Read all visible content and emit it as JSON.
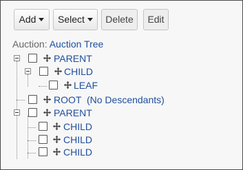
{
  "toolbar": {
    "add_label": "Add",
    "select_label": "Select",
    "delete_label": "Delete",
    "edit_label": "Edit"
  },
  "tree": {
    "title_prefix": "Auction:",
    "title_link": "Auction Tree",
    "nodes": [
      {
        "label": "PARENT",
        "level": 0,
        "expanded": true
      },
      {
        "label": "CHILD",
        "level": 1,
        "expanded": true
      },
      {
        "label": "LEAF",
        "level": 2
      },
      {
        "label": "ROOT  (No Descendants)",
        "level": 0
      },
      {
        "label": "PARENT",
        "level": 0,
        "expanded": true
      },
      {
        "label": "CHILD",
        "level": 1
      },
      {
        "label": "CHILD",
        "level": 1
      },
      {
        "label": "CHILD",
        "level": 1
      }
    ]
  },
  "colors": {
    "link": "#1f4e9c",
    "text_muted": "#666666",
    "frame_border": "#4a4a4a",
    "background": "#f7f7f7"
  },
  "icons": {
    "expander": "minus-box-icon",
    "move": "move-arrows-icon",
    "checkbox": "checkbox-icon"
  }
}
